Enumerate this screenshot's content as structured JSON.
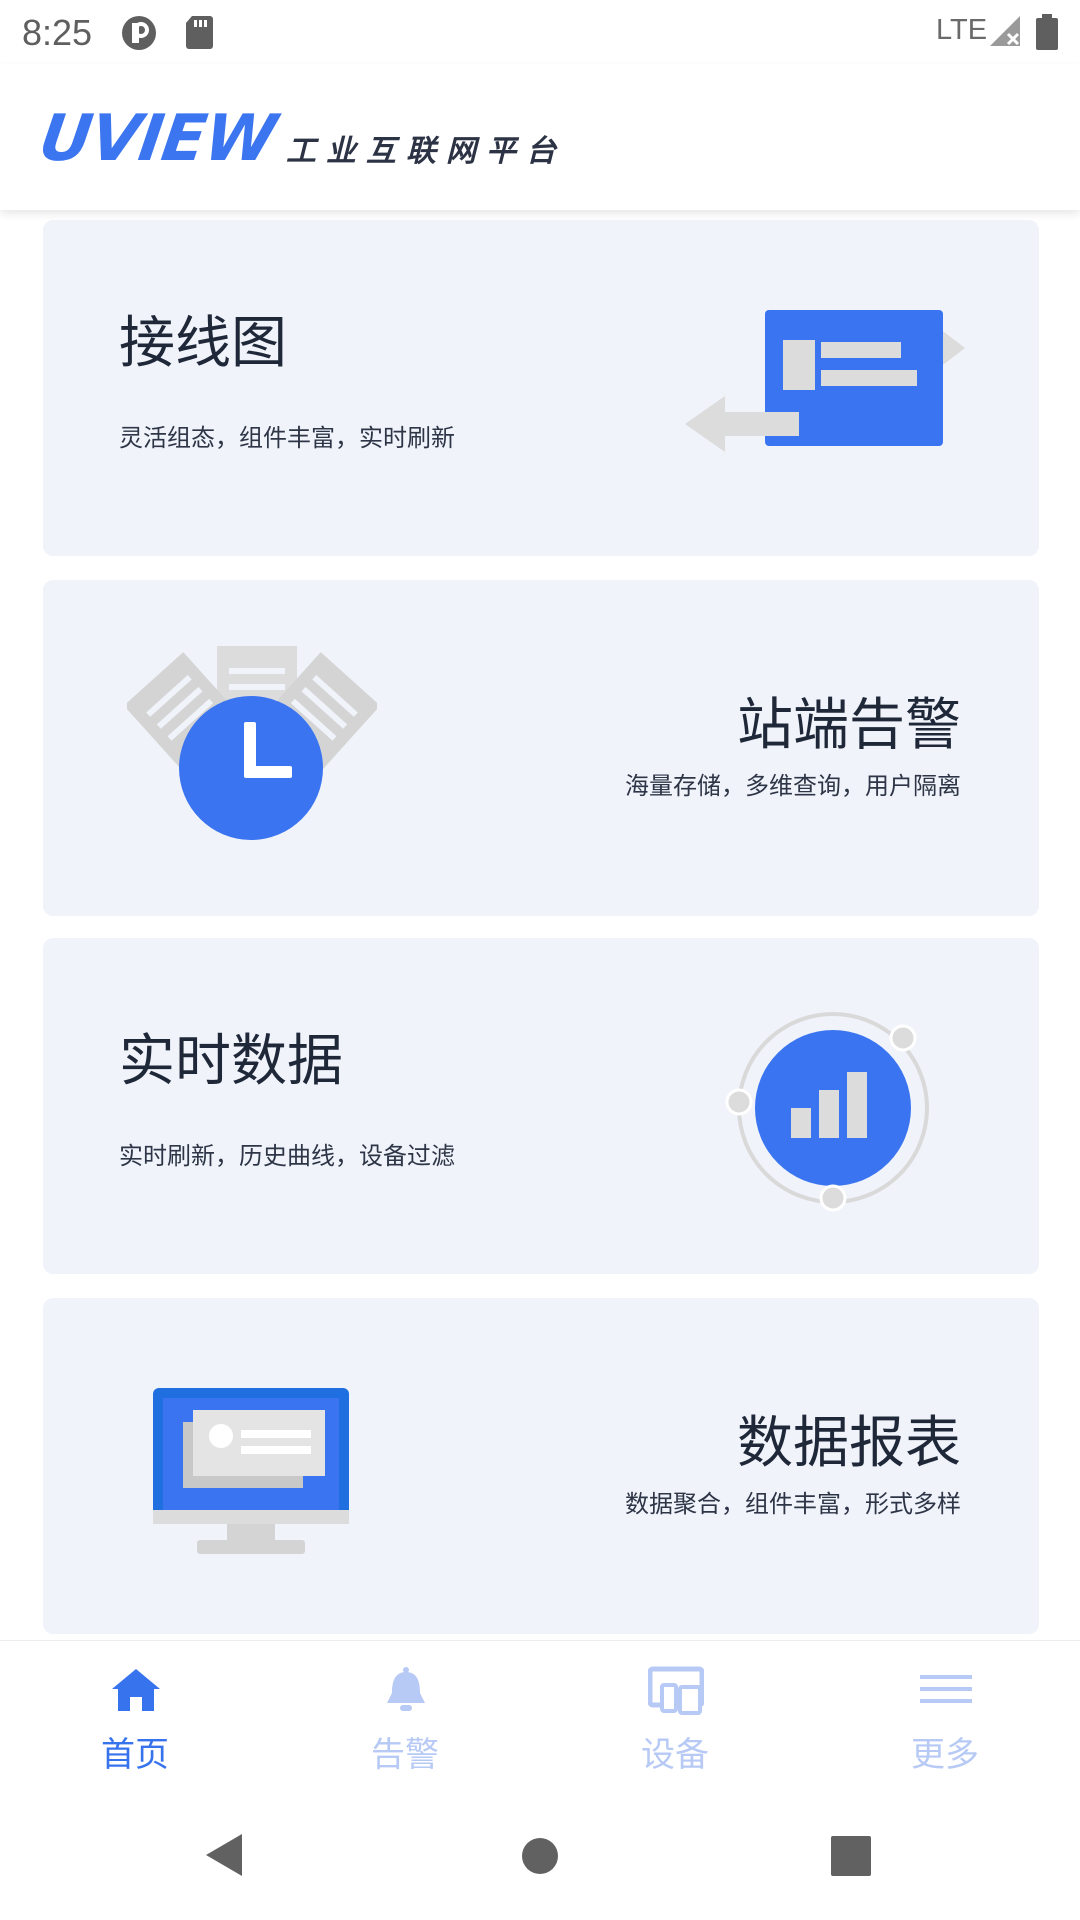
{
  "status_bar": {
    "time": "8:25",
    "network": "LTE",
    "icons": [
      "app-notification-icon",
      "sd-card-icon",
      "signal-icon",
      "battery-icon"
    ]
  },
  "header": {
    "logo": "UVIEW",
    "subtitle": "工业互联网平台"
  },
  "cards": [
    {
      "title": "接线图",
      "desc": "灵活组态，组件丰富，实时刷新",
      "icon": "wiring-diagram-icon"
    },
    {
      "title": "站端告警",
      "desc": "海量存储，多维查询，用户隔离",
      "icon": "alarm-clock-icon"
    },
    {
      "title": "实时数据",
      "desc": "实时刷新，历史曲线，设备过滤",
      "icon": "realtime-chart-icon"
    },
    {
      "title": "数据报表",
      "desc": "数据聚合，组件丰富，形式多样",
      "icon": "report-monitor-icon"
    }
  ],
  "tabbar": {
    "items": [
      {
        "label": "首页",
        "icon": "home-icon",
        "active": true
      },
      {
        "label": "告警",
        "icon": "bell-icon",
        "active": false
      },
      {
        "label": "设备",
        "icon": "devices-icon",
        "active": false
      },
      {
        "label": "更多",
        "icon": "menu-icon",
        "active": false
      }
    ]
  },
  "nav": {
    "buttons": [
      "back-icon",
      "home-circle-icon",
      "recents-icon"
    ]
  },
  "colors": {
    "accent": "#3873ee",
    "card_bg": "#f0f3fa",
    "inactive_tab": "#b7c9f5",
    "illustration_gray": "#d9d9d9"
  }
}
